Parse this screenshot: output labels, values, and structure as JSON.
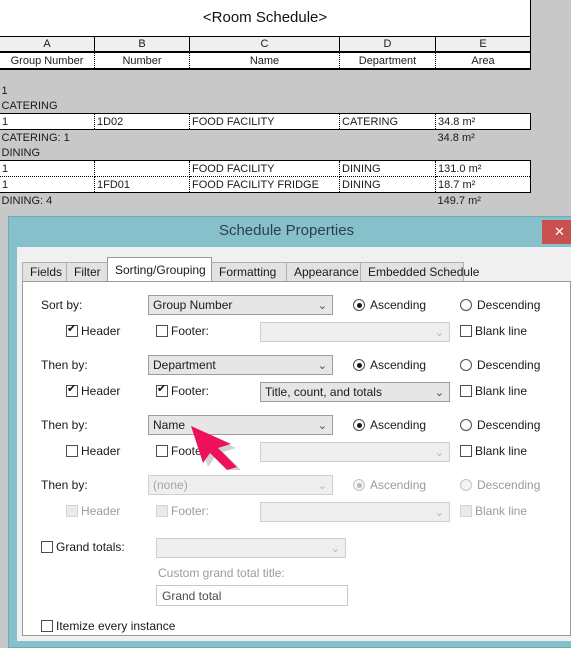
{
  "schedule": {
    "title": "<Room Schedule>",
    "column_letters": [
      "A",
      "B",
      "C",
      "D",
      "E"
    ],
    "column_headers": [
      "Group Number",
      "Number",
      "Name",
      "Department",
      "Area"
    ],
    "rows": [
      {
        "type": "blank",
        "cells": [
          "",
          "",
          "",
          "",
          ""
        ]
      },
      {
        "type": "group",
        "cells": [
          "1",
          "",
          "",
          "",
          ""
        ]
      },
      {
        "type": "group",
        "cells": [
          "CATERING",
          "",
          "",
          "",
          ""
        ]
      },
      {
        "type": "data",
        "cells": [
          "1",
          "1D02",
          "FOOD FACILITY",
          "CATERING",
          "34.8 m²"
        ]
      },
      {
        "type": "group",
        "cells": [
          "CATERING: 1",
          "",
          "",
          "",
          "34.8 m²"
        ]
      },
      {
        "type": "group",
        "cells": [
          "DINING",
          "",
          "",
          "",
          ""
        ]
      },
      {
        "type": "data_top",
        "cells": [
          "1",
          "",
          "FOOD FACILITY",
          "DINING",
          "131.0 m²"
        ]
      },
      {
        "type": "data_mid",
        "cells": [
          "1",
          "1FD01",
          "FOOD FACILITY FRIDGE",
          "DINING",
          "18.7 m²"
        ]
      },
      {
        "type": "group",
        "cells": [
          "DINING: 4",
          "",
          "",
          "",
          "149.7 m²"
        ]
      }
    ]
  },
  "dialog": {
    "title": "Schedule Properties",
    "close_label": "✕",
    "titlebar_color": "#86c0cb",
    "close_color": "#c8504f",
    "tabs": [
      {
        "label": "Fields",
        "active": false
      },
      {
        "label": "Filter",
        "active": false
      },
      {
        "label": "Sorting/Grouping",
        "active": true
      },
      {
        "label": "Formatting",
        "active": false
      },
      {
        "label": "Appearance",
        "active": false
      },
      {
        "label": "Embedded Schedule",
        "active": false
      }
    ],
    "sort_rows": [
      {
        "label": "Sort by:",
        "field_value": "Group Number",
        "ascending_label": "Ascending",
        "descending_label": "Descending",
        "direction": "ascending",
        "header_label": "Header",
        "header_checked": true,
        "footer_label": "Footer:",
        "footer_checked": false,
        "footer_value": "",
        "blank_line_label": "Blank line",
        "blank_line_checked": false,
        "enabled": true
      },
      {
        "label": "Then by:",
        "field_value": "Department",
        "ascending_label": "Ascending",
        "descending_label": "Descending",
        "direction": "ascending",
        "header_label": "Header",
        "header_checked": true,
        "footer_label": "Footer:",
        "footer_checked": true,
        "footer_value": "Title, count, and totals",
        "blank_line_label": "Blank line",
        "blank_line_checked": false,
        "enabled": true
      },
      {
        "label": "Then by:",
        "field_value": "Name",
        "ascending_label": "Ascending",
        "descending_label": "Descending",
        "direction": "ascending",
        "header_label": "Header",
        "header_checked": false,
        "footer_label": "Footer:",
        "footer_checked": false,
        "footer_value": "",
        "blank_line_label": "Blank line",
        "blank_line_checked": false,
        "enabled": true
      },
      {
        "label": "Then by:",
        "field_value": "(none)",
        "ascending_label": "Ascending",
        "descending_label": "Descending",
        "direction": "ascending",
        "header_label": "Header",
        "header_checked": false,
        "footer_label": "Footer:",
        "footer_checked": false,
        "footer_value": "",
        "blank_line_label": "Blank line",
        "blank_line_checked": false,
        "enabled": false
      }
    ],
    "grand_totals": {
      "label": "Grand totals:",
      "checked": false,
      "select_value": "",
      "custom_title_label": "Custom grand total title:",
      "custom_title_value": "Grand total"
    },
    "itemize": {
      "label": "Itemize every instance",
      "checked": false
    }
  },
  "annotation": {
    "arrow_color": "#ee1159",
    "points_to": "Name"
  }
}
